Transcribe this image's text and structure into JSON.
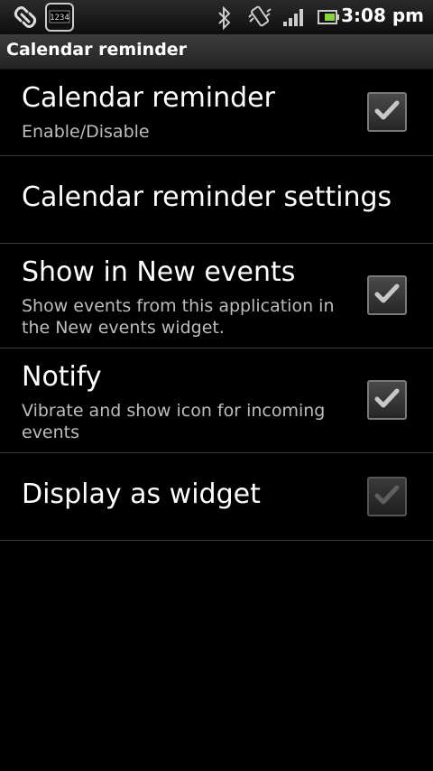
{
  "status_bar": {
    "time": "3:08 pm",
    "icons": [
      "link-icon",
      "keyboard-icon",
      "bluetooth-icon",
      "vibrate-icon",
      "signal-icon",
      "battery-icon"
    ],
    "keyboard_text": "1234"
  },
  "title_bar": {
    "title": "Calendar reminder"
  },
  "preferences": [
    {
      "title": "Calendar reminder",
      "summary": "Enable/Disable",
      "checked": true,
      "enabled": true
    },
    {
      "title": "Calendar reminder settings"
    },
    {
      "title": "Show in New events",
      "summary": "Show events from this application in the New events widget.",
      "checked": true,
      "enabled": true
    },
    {
      "title": "Notify",
      "summary": "Vibrate and show icon for incoming events",
      "checked": true,
      "enabled": true
    },
    {
      "title": "Display as widget",
      "checked": true,
      "enabled": false
    }
  ],
  "colors": {
    "background": "#000000",
    "divider": "#3a3a3a",
    "summary_text": "#bdbdbd",
    "check_enabled": "#c8c8c8",
    "check_disabled": "#5e5e5e"
  }
}
